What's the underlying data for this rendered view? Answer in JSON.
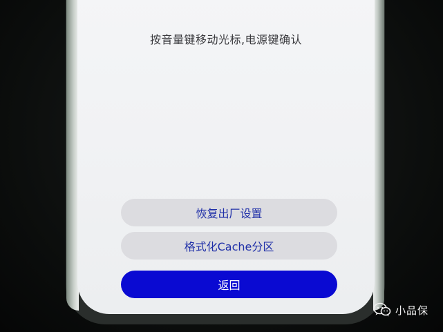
{
  "screen": {
    "header": "按音量键移动光标,电源键确认",
    "options": [
      {
        "label": "恢复出厂设置",
        "selected": false
      },
      {
        "label": "格式化Cache分区",
        "selected": false
      },
      {
        "label": "返回",
        "selected": true
      }
    ]
  },
  "colors": {
    "screen_bg": "#f1f2f4",
    "button_bg": "#dcdce0",
    "button_text": "#1f2fa8",
    "selected_bg": "#0a0ad2",
    "selected_text": "#ffffff"
  },
  "watermark": {
    "icon": "wechat-icon",
    "text": "小品保"
  }
}
